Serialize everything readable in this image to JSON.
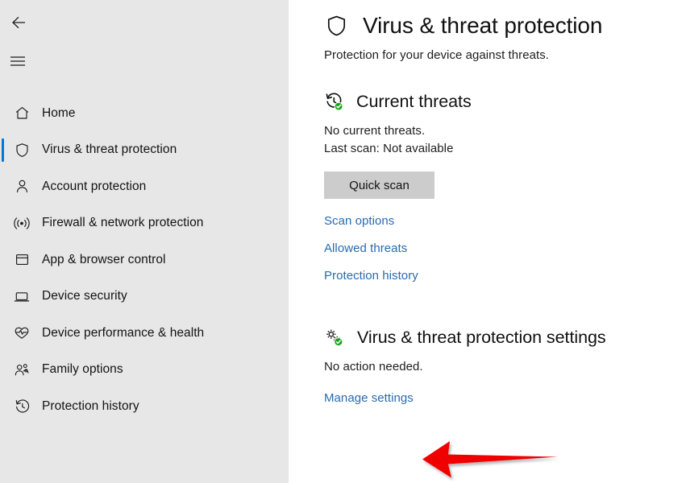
{
  "window": {
    "app": "Windows Security",
    "accent_color": "#0078d7",
    "sidebar_bg": "#e7e7e7",
    "link_color": "#2a6ab0",
    "annotation_color": "#f00000"
  },
  "sidebar": {
    "back_button_label": "Back",
    "menu_button_label": "Open navigation menu",
    "items": [
      {
        "label": "Home",
        "icon": "home-icon",
        "selected": false
      },
      {
        "label": "Virus & threat protection",
        "icon": "shield-icon",
        "selected": true
      },
      {
        "label": "Account protection",
        "icon": "person-icon",
        "selected": false
      },
      {
        "label": "Firewall & network protection",
        "icon": "wifi-icon",
        "selected": false
      },
      {
        "label": "App & browser control",
        "icon": "window-icon",
        "selected": false
      },
      {
        "label": "Device security",
        "icon": "laptop-icon",
        "selected": false
      },
      {
        "label": "Device performance & health",
        "icon": "heart-pulse-icon",
        "selected": false
      },
      {
        "label": "Family options",
        "icon": "people-icon",
        "selected": false
      },
      {
        "label": "Protection history",
        "icon": "history-clock-icon",
        "selected": false
      }
    ]
  },
  "main": {
    "header": {
      "icon": "shield-icon",
      "title": "Virus & threat protection",
      "subtitle": "Protection for your device against threats."
    },
    "current_threats": {
      "icon": "history-clock-check-icon",
      "title": "Current threats",
      "status_line_1": "No current threats.",
      "status_line_2": "Last scan: Not available",
      "scan_button": "Quick scan",
      "links": [
        "Scan options",
        "Allowed threats",
        "Protection history"
      ]
    },
    "protection_settings": {
      "icon": "gears-check-icon",
      "title": "Virus & threat protection settings",
      "status": "No action needed.",
      "link": "Manage settings"
    }
  },
  "annotation": {
    "type": "red-arrow",
    "points_to": "Manage settings",
    "direction": "left"
  }
}
